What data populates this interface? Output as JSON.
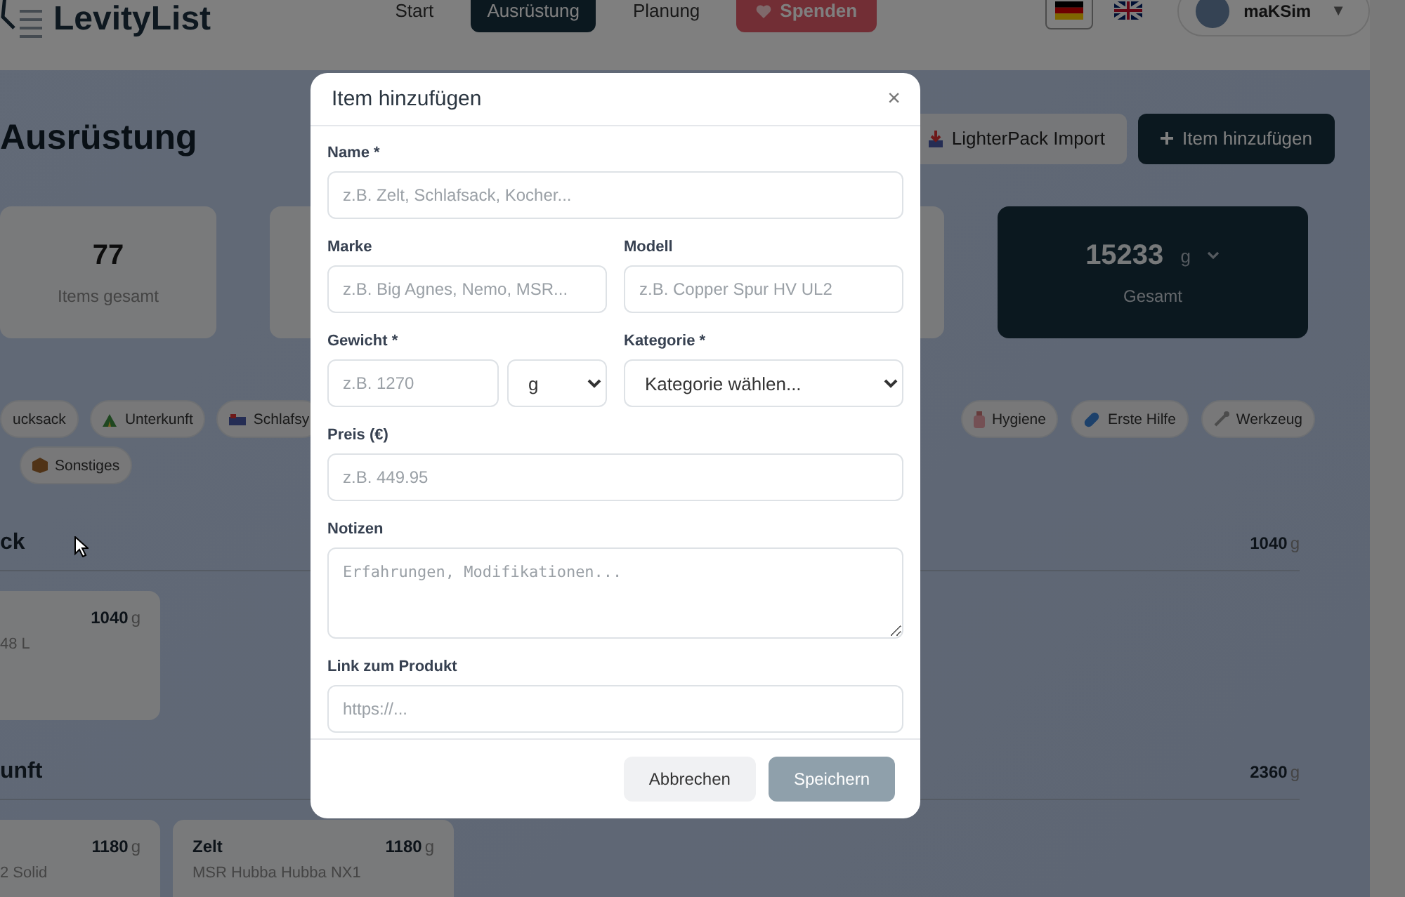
{
  "header": {
    "logo": "LevityList",
    "nav": [
      {
        "label": "Start",
        "selected": false,
        "kind": "link"
      },
      {
        "label": "Ausrüstung",
        "selected": true,
        "kind": "link"
      },
      {
        "label": "Planung",
        "selected": false,
        "kind": "link"
      },
      {
        "label": "Spenden",
        "selected": false,
        "kind": "donate"
      }
    ],
    "languages": [
      {
        "kind": "de",
        "selected": true
      },
      {
        "kind": "en",
        "selected": false
      }
    ],
    "user": {
      "name": "maKSim",
      "caret": "▼"
    }
  },
  "page": {
    "title": "Ausrüstung",
    "actions": [
      {
        "label": "LighterPack Import",
        "kind": "secondary"
      },
      {
        "label": "Item hinzufügen",
        "kind": "primary"
      }
    ]
  },
  "stats": [
    {
      "kind": "light",
      "value": "77",
      "label": "Items gesamt"
    },
    {
      "kind": "light"
    },
    {
      "kind": "light"
    },
    {
      "kind": "dark",
      "value": "15233",
      "unit": "g",
      "label": "Gesamt"
    }
  ],
  "category_rows": [
    {
      "left": [
        {
          "label": "ucksack"
        },
        {
          "label": "Unterkunft"
        },
        {
          "label": "Schlafsy"
        }
      ],
      "right": [
        {
          "label": "Hygiene"
        },
        {
          "label": "Erste Hilfe"
        },
        {
          "label": "Werkzeug"
        }
      ]
    },
    {
      "left": [
        {
          "label": "Sonstiges"
        }
      ]
    }
  ],
  "sections": [
    {
      "title": "ck",
      "total": "1040",
      "unit": "g",
      "items": [
        {
          "weight": "1040",
          "unit": "g",
          "detail": "48 L"
        }
      ]
    },
    {
      "title": "unft",
      "total": "2360",
      "unit": "g",
      "items": [
        {
          "weight": "1180",
          "unit": "g",
          "detail": "2 Solid"
        },
        {
          "name": "Zelt",
          "weight": "1180",
          "unit": "g",
          "detail": "MSR Hubba Hubba NX1"
        }
      ]
    }
  ],
  "dialog": {
    "title": "Item hinzufügen",
    "close": "×",
    "rows": [
      [
        {
          "kind": "text",
          "label": "Name *",
          "placeholder": "z.B. Zelt, Schlafsack, Kocher..."
        }
      ],
      [
        {
          "kind": "text",
          "label": "Marke",
          "placeholder": "z.B. Big Agnes, Nemo, MSR..."
        },
        {
          "kind": "text",
          "label": "Modell",
          "placeholder": "z.B. Copper Spur HV UL2"
        }
      ],
      [
        {
          "kind": "weight",
          "label": "Gewicht *",
          "placeholder": "z.B. 1270",
          "unit": "g"
        },
        {
          "kind": "select",
          "label": "Kategorie *",
          "value": "Kategorie wählen..."
        }
      ],
      [
        {
          "kind": "text",
          "label": "Preis (€)",
          "placeholder": "z.B. 449.95"
        }
      ],
      [
        {
          "kind": "textarea",
          "label": "Notizen",
          "placeholder": "Erfahrungen, Modifikationen..."
        }
      ],
      [
        {
          "kind": "text",
          "label": "Link zum Produkt",
          "placeholder": "https://..."
        }
      ]
    ],
    "buttons": [
      {
        "label": "Abbrechen",
        "kind": "secondary",
        "disabled": false
      },
      {
        "label": "Speichern",
        "kind": "primary",
        "disabled": true
      }
    ]
  }
}
